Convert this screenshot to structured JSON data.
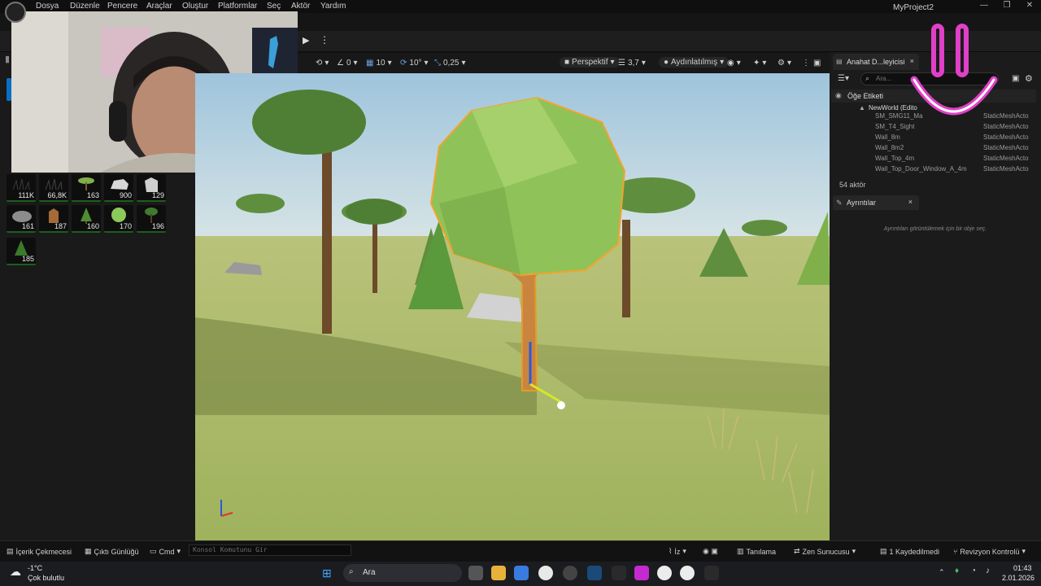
{
  "menu": {
    "items": [
      "Dosya",
      "Düzenle",
      "Pencere",
      "Araçlar",
      "Oluştur",
      "Platformlar",
      "Seç",
      "Aktör",
      "Yardım"
    ],
    "project_title": "MyProject2",
    "window_controls": [
      "—",
      "❐",
      "✕"
    ]
  },
  "left_panel": {
    "assets": [
      {
        "count": "111K",
        "icon": "grass-icon"
      },
      {
        "count": "66,8K",
        "icon": "grass-icon"
      },
      {
        "count": "163",
        "icon": "flat-tree-icon"
      },
      {
        "count": "900",
        "icon": "rock-icon"
      },
      {
        "count": "129",
        "icon": "rock-icon"
      },
      {
        "count": "161",
        "icon": "rock-icon"
      },
      {
        "count": "187",
        "icon": "stump-icon"
      },
      {
        "count": "160",
        "icon": "pine-tree-icon"
      },
      {
        "count": "170",
        "icon": "bush-icon"
      },
      {
        "count": "196",
        "icon": "tree-icon"
      },
      {
        "count": "185",
        "icon": "pine-tree-icon"
      }
    ]
  },
  "viewport_toolbar": {
    "rotate_snap": "0",
    "grid_snap": "10",
    "angle_snap": "10°",
    "scale_snap": "0,25",
    "view_mode": "Perspektif",
    "camera_speed": "3,7",
    "lighting": "Aydınlatılmış"
  },
  "outliner": {
    "tab_label": "Anahat D...leyicisi",
    "search_placeholder": "Ara...",
    "header_label": "Öğe Etiketi",
    "world_label": "NewWorld (Edito",
    "rows": [
      {
        "name": "SM_SMG11_Ma",
        "type": "StaticMeshActo"
      },
      {
        "name": "SM_T4_Sight",
        "type": "StaticMeshActo"
      },
      {
        "name": "Wall_8m",
        "type": "StaticMeshActo"
      },
      {
        "name": "Wall_8m2",
        "type": "StaticMeshActo"
      },
      {
        "name": "Wall_Top_4m",
        "type": "StaticMeshActo"
      },
      {
        "name": "Wall_Top_Door_Window_A_4m",
        "type": "StaticMeshActo"
      }
    ],
    "actor_count": "54 aktör"
  },
  "details": {
    "tab_label": "Ayrıntılar",
    "empty_message": "Ayrıntıları görüntülemek için bir obje seç."
  },
  "statusbar": {
    "content_drawer": "İçerik Çekmecesi",
    "output_log": "Çıktı Günlüğü",
    "cmd": "Cmd",
    "console_placeholder": "Konsol Komutunu Gir",
    "trace": "İz",
    "diagnostics": "Tanılama",
    "zen_server": "Zen Sunucusu",
    "unsaved": "1 Kaydedilmedi",
    "revision_control": "Revizyon Kontrolü"
  },
  "taskbar": {
    "weather_temp": "-1°C",
    "weather_desc": "Çok bulutlu",
    "search_label": "Ara",
    "time": "01:43",
    "date": "2.01.2026"
  },
  "colors": {
    "accent_blue": "#0a6fc4",
    "asset_underline": "#1c5f1c",
    "sky": "#b9d6e6",
    "ground": "#a9b964",
    "smiley": "#e040c8"
  }
}
